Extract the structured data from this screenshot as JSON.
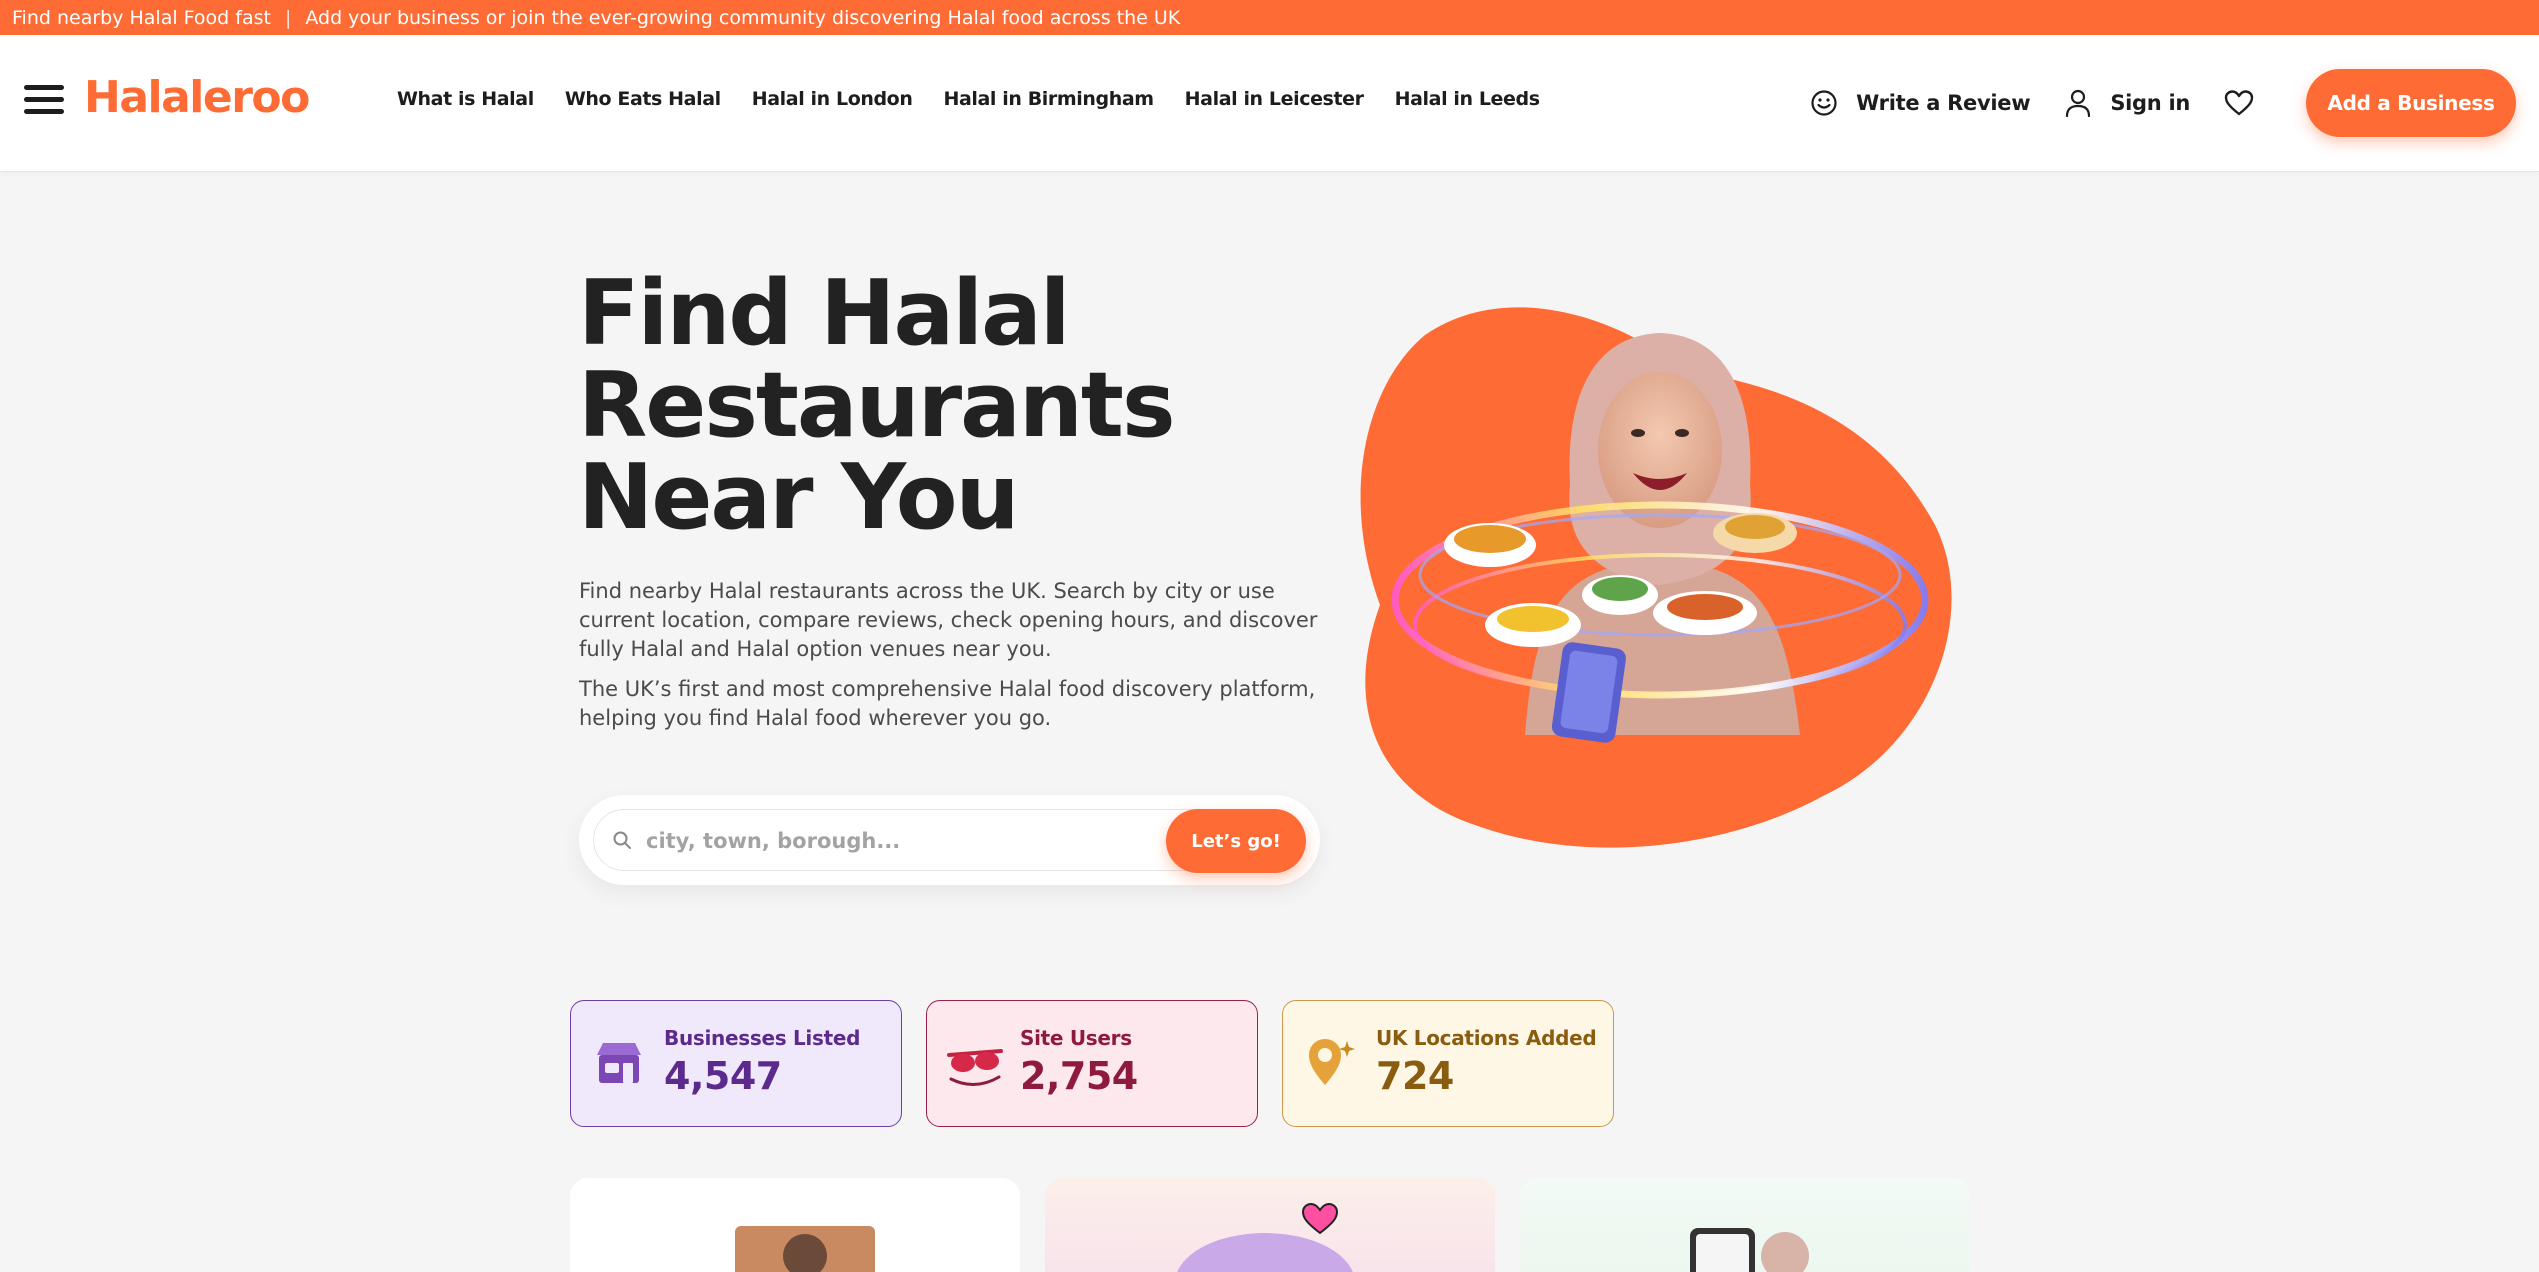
{
  "topbar": {
    "left": "Find nearby Halal Food fast",
    "separator": "|",
    "right": "Add your business or join the ever-growing community discovering Halal food across the UK"
  },
  "header": {
    "logo": "Halaleroo",
    "nav": [
      "What is Halal",
      "Who Eats Halal",
      "Halal in London",
      "Halal in Birmingham",
      "Halal in Leicester",
      "Halal in Leeds"
    ],
    "write_review": "Write a Review",
    "sign_in": "Sign in",
    "add_business": "Add a Business"
  },
  "hero": {
    "title_line1": "Find Halal",
    "title_line2": "Restaurants",
    "title_line3": "Near You",
    "para1": "Find nearby Halal restaurants across the UK. Search by city or use current location, compare reviews, check opening hours, and discover fully Halal and Halal option venues near you.",
    "para2": "The UK’s first and most comprehensive Halal food discovery platform, helping you find Halal food wherever you go.",
    "search_placeholder": "city, town, borough...",
    "search_button": "Let’s go!"
  },
  "stats": [
    {
      "label": "Businesses Listed",
      "value": "4,547"
    },
    {
      "label": "Site Users",
      "value": "2,754"
    },
    {
      "label": "UK Locations Added",
      "value": "724"
    }
  ],
  "colors": {
    "brand": "#ff6b35",
    "text_dark": "#222222"
  }
}
